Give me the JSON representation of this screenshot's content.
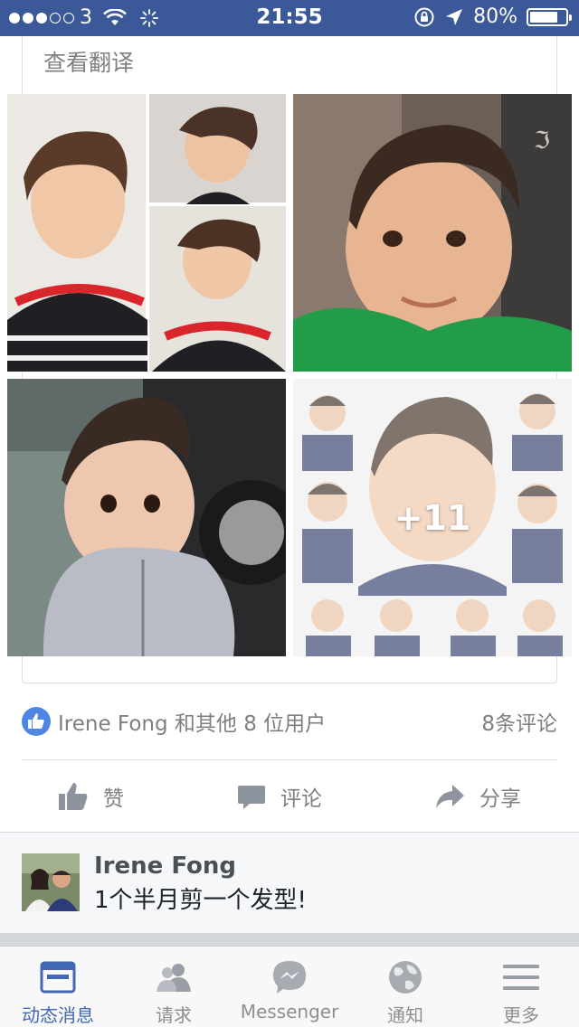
{
  "status_bar": {
    "carrier": "3",
    "time": "21:55",
    "battery_percent": "80%",
    "battery_level": 0.8
  },
  "post": {
    "translate_link": "查看翻译",
    "more_photos_label": "+11",
    "reaction_summary": "Irene Fong 和其他 8 位用户",
    "comment_count": "8条评论",
    "actions": {
      "like": "赞",
      "comment": "评论",
      "share": "分享"
    }
  },
  "comment_preview": {
    "author": "Irene Fong",
    "text": "1个半月剪一个发型!"
  },
  "tabbar": {
    "tabs": [
      {
        "label": "动态消息",
        "icon": "news-feed-icon",
        "active": true
      },
      {
        "label": "请求",
        "icon": "friend-requests-icon",
        "active": false
      },
      {
        "label": "Messenger",
        "icon": "messenger-icon",
        "active": false
      },
      {
        "label": "通知",
        "icon": "globe-notifications-icon",
        "active": false
      },
      {
        "label": "更多",
        "icon": "menu-icon",
        "active": false
      }
    ]
  },
  "colors": {
    "brand": "#3b5998",
    "active_tab": "#4267b2",
    "like_badge": "#4e86e4"
  }
}
